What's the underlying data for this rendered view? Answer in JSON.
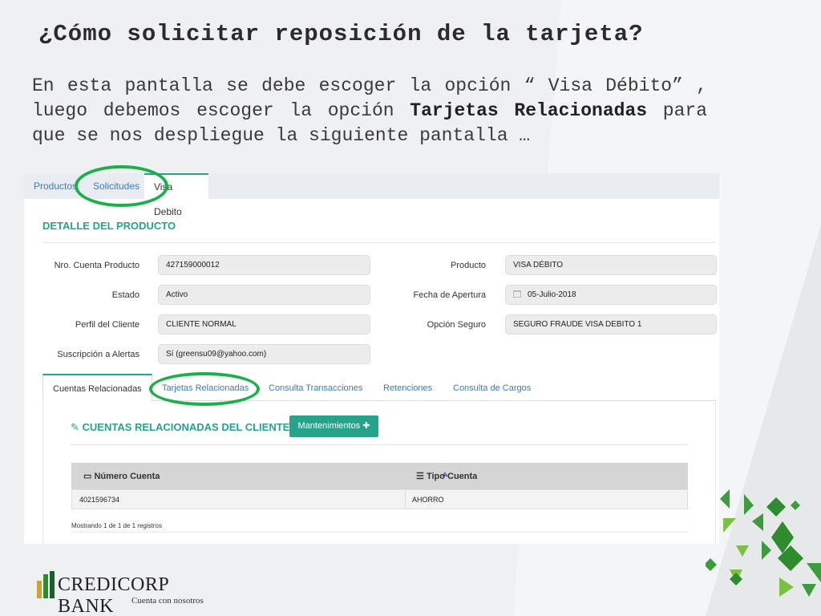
{
  "slide": {
    "title": "¿Cómo solicitar reposición de la tarjeta?",
    "intro_1": "En esta pantalla se debe escoger la opción “ Visa Débito” , luego debemos escoger la opción ",
    "intro_bold": "Tarjetas Relacionadas",
    "intro_2": " para que se nos despliegue la siguiente pantalla …"
  },
  "topnav": {
    "tabs": [
      "Productos",
      "Solicitudes",
      "Visa Debito"
    ],
    "active": "Visa Debito"
  },
  "detail": {
    "title": "DETALLE DEL PRODUCTO",
    "fields": {
      "nro_cuenta_label": "Nro. Cuenta Producto",
      "nro_cuenta_value": "427159000012",
      "estado_label": "Estado",
      "estado_value": "Activo",
      "perfil_label": "Perfil del Cliente",
      "perfil_value": "CLIENTE NORMAL",
      "alertas_label": "Suscripción a Alertas",
      "alertas_value": "Sí (greensu09@yahoo.com)",
      "producto_label": "Producto",
      "producto_value": "VISA DÉBITO",
      "fecha_label": "Fecha de Apertura",
      "fecha_value": "05-Julio-2018",
      "seguro_label": "Opción Seguro",
      "seguro_value": "SEGURO FRAUDE VISA DEBITO 1"
    }
  },
  "subtabs": [
    "Cuentas Relacionadas",
    "Tarjetas Relacionadas",
    "Consulta Transacciones",
    "Retenciones",
    "Consulta de Cargos"
  ],
  "related": {
    "title": "CUENTAS RELACIONADAS DEL CLIENTE",
    "button": "Mantenimientos",
    "columns": [
      "Número Cuenta",
      "Tipo Cuenta"
    ],
    "rows": [
      [
        "4021596734",
        "AHORRO"
      ]
    ],
    "showing": "Mostrando 1 de 1 de 1 registros"
  },
  "brand": {
    "name": "CREDICORP BANK",
    "tagline": "Cuenta con nosotros",
    "accent": "#28a28d",
    "highlight": "#1bb04a"
  }
}
